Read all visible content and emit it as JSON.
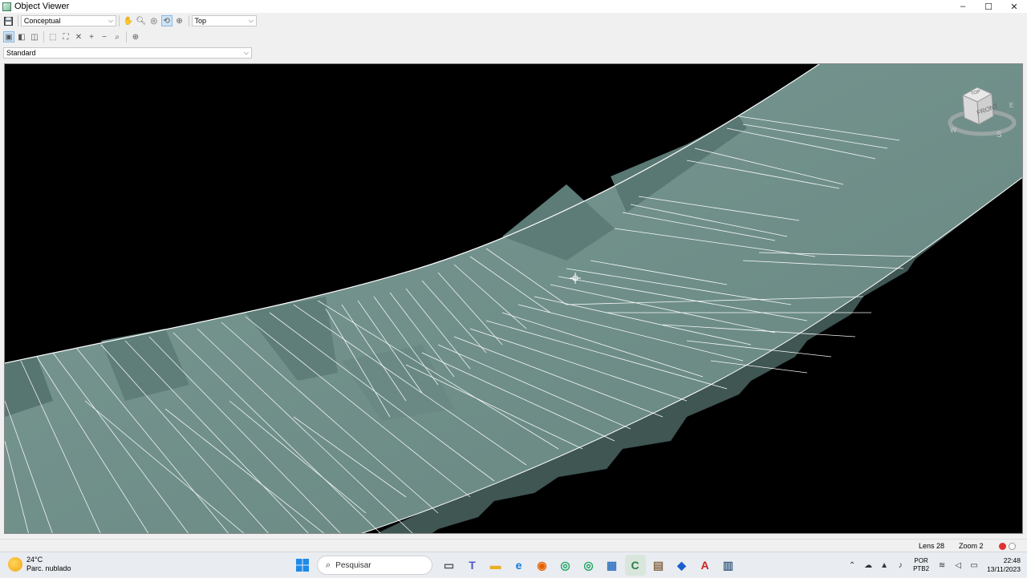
{
  "window": {
    "title": "Object Viewer",
    "controls": [
      "–",
      "☐",
      "✕"
    ]
  },
  "toolbar1": {
    "visual_style": "Conceptual",
    "view": "Top"
  },
  "toolbar3": {
    "view_preset": "Standard"
  },
  "viewcube": {
    "face_top": "TOP",
    "face_front": "FRONT",
    "compass_w": "W",
    "compass_s": "S",
    "compass_e": "E"
  },
  "status": {
    "lens": "Lens 28",
    "zoom": "Zoom 2"
  },
  "colors": {
    "surface": "#6e8f8a",
    "surface_dark": "#4f6c68",
    "edges": "#ffffff",
    "background": "#000000",
    "record": "#e03030"
  },
  "taskbar": {
    "weather_temp": "24°C",
    "weather_desc": "Parc. nublado",
    "search_placeholder": "Pesquisar",
    "lang1": "POR",
    "lang2": "PTB2",
    "time": "22:48",
    "date": "13/11/2023"
  }
}
